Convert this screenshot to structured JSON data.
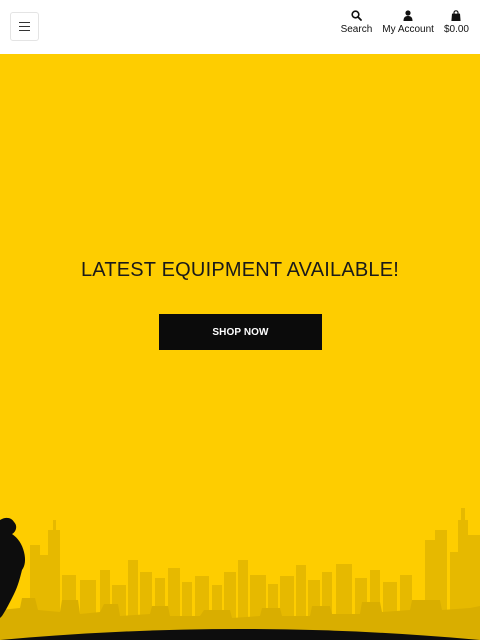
{
  "header": {
    "menu_icon": "hamburger-menu-icon",
    "actions": [
      {
        "icon": "search-icon",
        "label": "Search"
      },
      {
        "icon": "user-icon",
        "label": "My Account"
      },
      {
        "icon": "shopping-bag-icon",
        "label": "$0.00"
      }
    ]
  },
  "hero": {
    "heading": "LATEST EQUIPMENT AVAILABLE!",
    "cta_label": "SHOP NOW",
    "background_color": "#fecd00",
    "cta_color": "#0b0b0b",
    "decoration": "city-skyline-with-runner-silhouette"
  }
}
